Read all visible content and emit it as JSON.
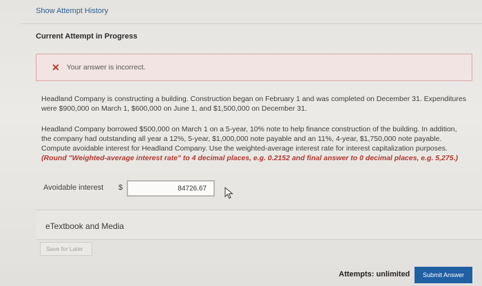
{
  "header": {
    "show_history_link": "Show Attempt History",
    "section_title": "Current Attempt in Progress"
  },
  "alert": {
    "icon": "close-icon",
    "message": "Your answer is incorrect."
  },
  "question": {
    "paragraph1": "Headland Company is constructing a building. Construction began on February 1 and was completed on December 31. Expenditures were $900,000 on March 1, $600,000 on June 1, and $1,500,000 on December 31.",
    "paragraph2": "Headland Company borrowed $500,000 on March 1 on a 5-year, 10% note to help finance construction of the building. In addition, the company had outstanding all year a 12%, 5-year, $1,000,000 note payable and an 11%, 4-year, $1,750,000 note payable. Compute avoidable interest for Headland Company. Use the weighted-average interest rate for interest capitalization purposes.",
    "hint": "(Round \"Weighted-average interest rate\" to 4 decimal places, e.g. 0.2152 and final answer to 0 decimal places, e.g. 5,275.)"
  },
  "answer": {
    "label": "Avoidable interest",
    "currency_symbol": "$",
    "value": "84726.67"
  },
  "resources": {
    "etextbook_label": "eTextbook and Media"
  },
  "footer": {
    "save_label": "Save for Later",
    "attempts_text": "Attempts: unlimited",
    "submit_label": "Submit Answer"
  },
  "colors": {
    "accent_blue": "#1f5fa3",
    "error_red": "#c0392b",
    "alert_bg": "#f2e4e2"
  }
}
